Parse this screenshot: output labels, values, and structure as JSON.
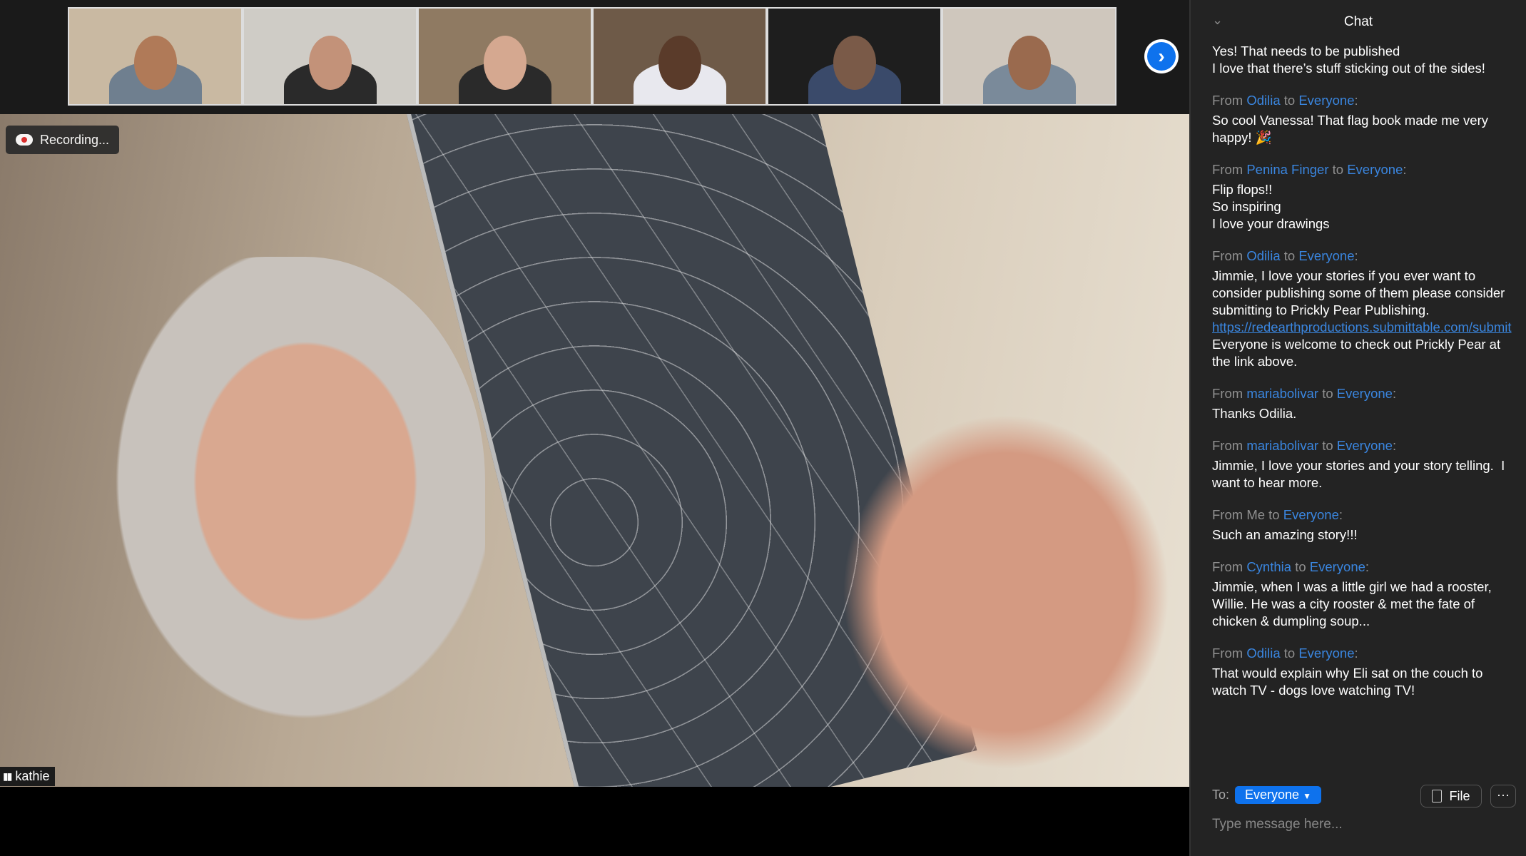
{
  "recording_label": "Recording...",
  "speaker_name": "kathie",
  "thumbnails": [
    {
      "bg": "#c9b9a2",
      "face": "#b07a58",
      "body": "#6f7f8f"
    },
    {
      "bg": "#cfccc6",
      "face": "#c39279",
      "body": "#2a2a2a"
    },
    {
      "bg": "#8f7a62",
      "face": "#d5a890",
      "body": "#2a2a2a"
    },
    {
      "bg": "#6e5a48",
      "face": "#5a3b2a",
      "body": "#e8e8ee"
    },
    {
      "bg": "#1e1e1e",
      "face": "#7a5a48",
      "body": "#3a4a6a"
    },
    {
      "bg": "#cfc7bd",
      "face": "#9a6a4e",
      "body": "#7a8a9a"
    }
  ],
  "chat": {
    "title": "Chat",
    "messages": [
      {
        "from": "",
        "to": "",
        "text": "Yes! That needs to be published\nI love that there’s stuff sticking out of the sides!"
      },
      {
        "from": "Odilia",
        "to": "Everyone",
        "text": "So cool Vanessa! That flag book made me very happy! 🎉"
      },
      {
        "from": "Penina Finger",
        "to": "Everyone",
        "text": "Flip flops!!\nSo inspiring\nI love your drawings"
      },
      {
        "from": "Odilia",
        "to": "Everyone",
        "text": "Jimmie, I love your stories if you ever want to consider publishing some of them please consider submitting to Prickly Pear Publishing.",
        "link": "https://redearthproductions.submittable.com/submit",
        "after": "Everyone is welcome to check out Prickly Pear at the link above."
      },
      {
        "from": "mariabolivar",
        "to": "Everyone",
        "text": "Thanks Odilia."
      },
      {
        "from": "mariabolivar",
        "to": "Everyone",
        "text": "Jimmie, I love your stories and your story telling.  I want to hear more."
      },
      {
        "from": "Me",
        "to": "Everyone",
        "self": true,
        "text": "Such an amazing story!!!"
      },
      {
        "from": "Cynthia",
        "to": "Everyone",
        "text": "Jimmie, when I was a little girl we had a rooster, Willie. He was a city rooster & met the fate of chicken & dumpling soup..."
      },
      {
        "from": "Odilia",
        "to": "Everyone",
        "text": "That would explain why Eli sat on the couch to watch TV - dogs love watching TV!"
      }
    ],
    "from_word": "From",
    "to_word": "to",
    "to_label": "To:",
    "recipient": "Everyone",
    "file_label": "File",
    "more_label": "···",
    "input_placeholder": "Type message here..."
  },
  "colors": {
    "accent": "#0e72ed",
    "name": "#3a86e0"
  }
}
